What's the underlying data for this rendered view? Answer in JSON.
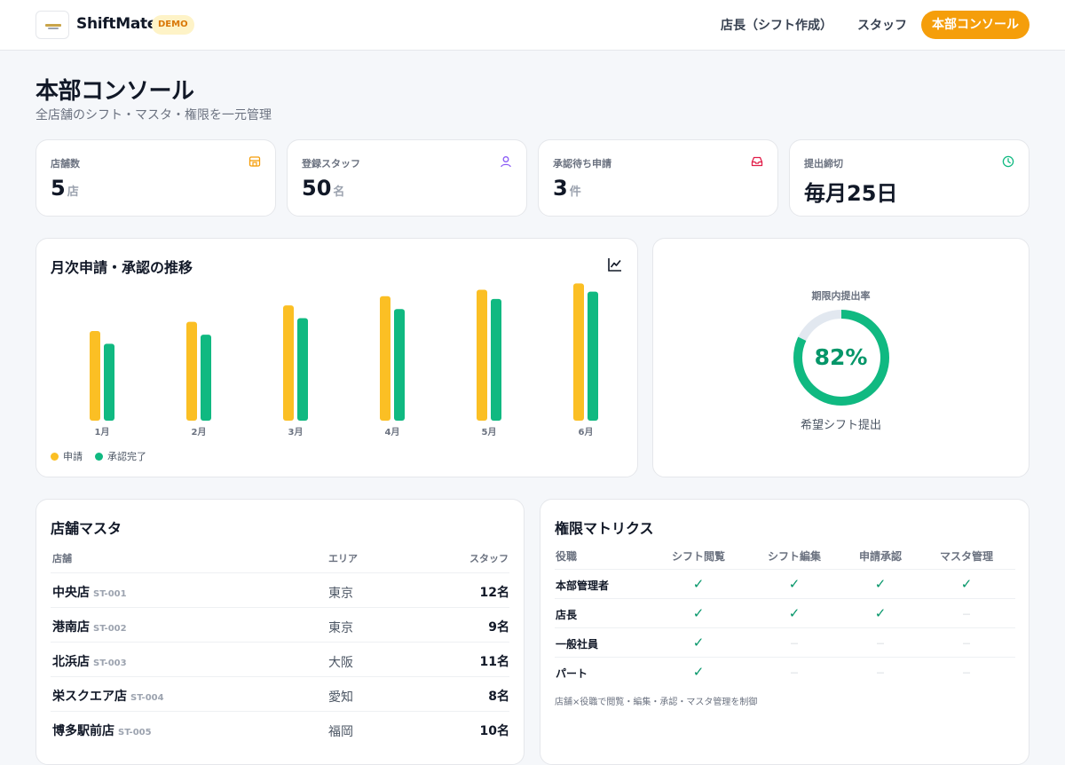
{
  "header": {
    "app_name": "ShiftMate",
    "badge": "DEMO",
    "nav": [
      "店長（シフト作成）",
      "スタッフ"
    ],
    "active_nav": "本部コンソール"
  },
  "page": {
    "title": "本部コンソール",
    "subtitle": "全店舗のシフト・マスタ・権限を一元管理"
  },
  "kpis": [
    {
      "label": "店舗数",
      "value": "5",
      "unit": "店",
      "icon": "store-icon",
      "color": "#f59e0b"
    },
    {
      "label": "登録スタッフ",
      "value": "50",
      "unit": "名",
      "icon": "user-icon",
      "color": "#8b5cf6"
    },
    {
      "label": "承認待ち申請",
      "value": "3",
      "unit": "件",
      "icon": "inbox-icon",
      "color": "#e11d48"
    },
    {
      "label": "提出締切",
      "value": "毎月25日",
      "unit": "",
      "icon": "clock-icon",
      "color": "#10b981"
    }
  ],
  "chart_panel": {
    "title": "月次申請・承認の推移",
    "icon": "line-chart-icon"
  },
  "chart_data": {
    "type": "bar",
    "categories": [
      "1月",
      "2月",
      "3月",
      "4月",
      "5月",
      "6月"
    ],
    "series": [
      {
        "name": "申請",
        "values": [
          98,
          108,
          126,
          136,
          143,
          150
        ],
        "color": "#fbbf24"
      },
      {
        "name": "承認完了",
        "values": [
          84,
          94,
          112,
          122,
          133,
          141
        ],
        "color": "#10b981"
      }
    ],
    "ylim": [
      0,
      160
    ],
    "grid": false,
    "legend": "bottom-left"
  },
  "gauge": {
    "label": "期限内提出率",
    "value_text": "82%",
    "fraction": 0.82,
    "caption": "希望シフト提出",
    "color": "#10b981",
    "track_color": "#e2e8f0"
  },
  "stores": {
    "title": "店舗マスタ",
    "headers": [
      "店舗",
      "エリア",
      "スタッフ"
    ],
    "rows": [
      {
        "name": "中央店",
        "code": "ST-001",
        "area": "東京",
        "staff": "12名"
      },
      {
        "name": "港南店",
        "code": "ST-002",
        "area": "東京",
        "staff": "9名"
      },
      {
        "name": "北浜店",
        "code": "ST-003",
        "area": "大阪",
        "staff": "11名"
      },
      {
        "name": "栄スクエア店",
        "code": "ST-004",
        "area": "愛知",
        "staff": "8名"
      },
      {
        "name": "博多駅前店",
        "code": "ST-005",
        "area": "福岡",
        "staff": "10名"
      }
    ]
  },
  "permissions": {
    "title": "権限マトリクス",
    "headers": [
      "役職",
      "シフト閲覧",
      "シフト編集",
      "申請承認",
      "マスタ管理"
    ],
    "yes_mark": "✓",
    "no_mark": "－",
    "rows": [
      {
        "role": "本部管理者",
        "cells": [
          true,
          true,
          true,
          true
        ]
      },
      {
        "role": "店長",
        "cells": [
          true,
          true,
          true,
          false
        ]
      },
      {
        "role": "一般社員",
        "cells": [
          true,
          false,
          false,
          false
        ]
      },
      {
        "role": "パート",
        "cells": [
          true,
          false,
          false,
          false
        ]
      }
    ],
    "note": "店舗×役職で閲覧・編集・承認・マスタ管理を制御"
  }
}
